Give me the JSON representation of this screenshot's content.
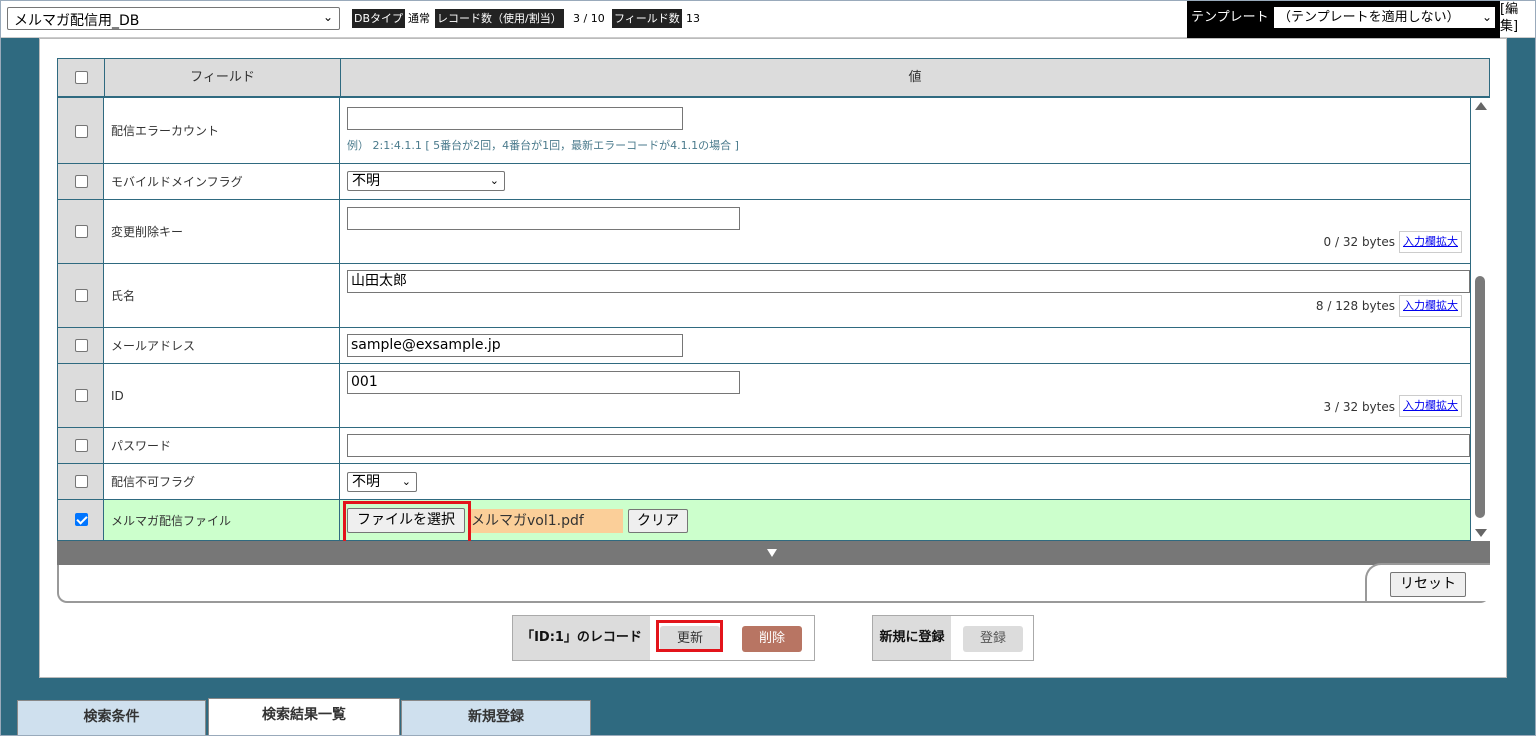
{
  "topbar": {
    "db_select": "メルマガ配信用_DB",
    "db_type_label": "DBタイプ",
    "db_type_value": "通常",
    "record_count_label": "レコード数（使用/割当）",
    "record_count_value": "3 / 10",
    "field_count_label": "フィールド数",
    "field_count_value": "13",
    "template_label": "テンプレート",
    "template_select": "（テンプレートを適用しない）",
    "edit_link": "[編集]"
  },
  "table": {
    "header_field": "フィールド",
    "header_value": "値",
    "rows": [
      {
        "field": "配信エラーカウント",
        "value": "",
        "hint": "例） 2:1:4.1.1 [ 5番台が2回，4番台が1回，最新エラーコードが4.1.1の場合 ]",
        "checked": false
      },
      {
        "field": "モバイルドメインフラグ",
        "value": "不明",
        "checked": false
      },
      {
        "field": "変更削除キー",
        "value": "",
        "bytes": "0 / 32 bytes",
        "expand": "入力欄拡大",
        "checked": false
      },
      {
        "field": "氏名",
        "value": "山田太郎",
        "bytes": "8 / 128 bytes",
        "expand": "入力欄拡大",
        "checked": false
      },
      {
        "field": "メールアドレス",
        "value": "sample@exsample.jp",
        "checked": false
      },
      {
        "field": "ID",
        "value": "001",
        "bytes": "3 / 32 bytes",
        "expand": "入力欄拡大",
        "checked": false
      },
      {
        "field": "パスワード",
        "value": "",
        "checked": false
      },
      {
        "field": "配信不可フラグ",
        "value": "不明",
        "checked": false
      },
      {
        "field": "メルマガ配信ファイル",
        "file_button": "ファイルを選択",
        "file_name": "メルマガvol1.pdf",
        "clear_button": "クリア",
        "checked": true
      }
    ]
  },
  "reset_button": "リセット",
  "record_actions": {
    "label": "「ID:1」のレコード",
    "update_button": "更新",
    "delete_button": "削除"
  },
  "new_actions": {
    "label": "新規に登録",
    "register_button": "登録"
  },
  "tabs": [
    {
      "label": "検索条件",
      "active": false
    },
    {
      "label": "検索結果一覧",
      "active": true
    },
    {
      "label": "新規登録",
      "active": false
    }
  ],
  "colors": {
    "accent": "#2f6a80",
    "highlight": "#e3141b",
    "file_row": "#ccffcc",
    "delete_button": "#b87563"
  }
}
